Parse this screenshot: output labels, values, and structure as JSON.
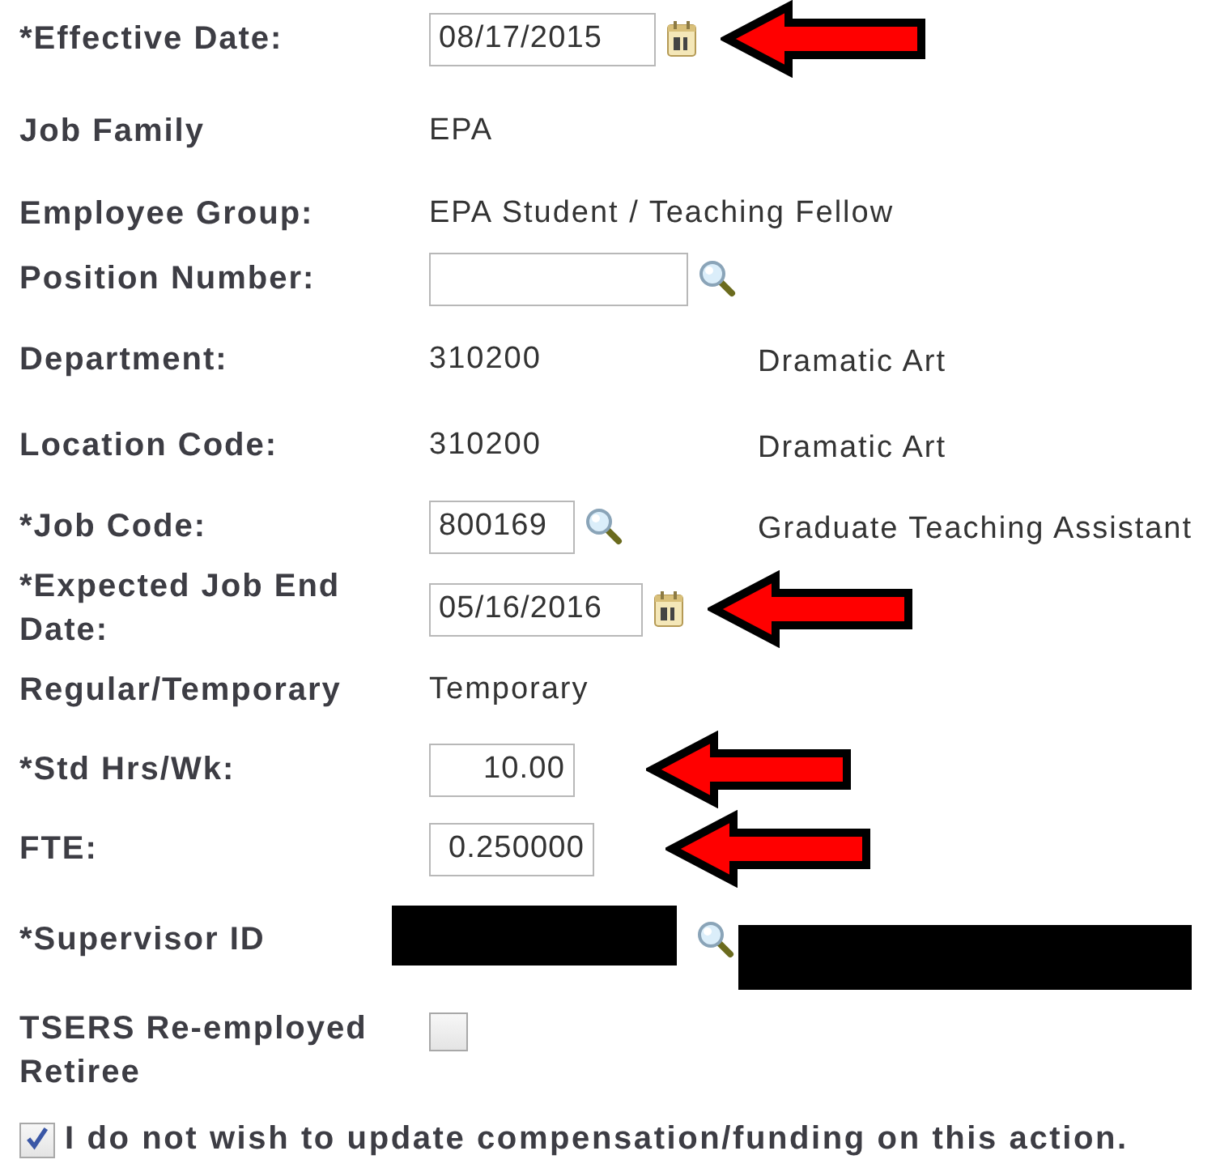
{
  "form": {
    "fields": [
      {
        "label": "*Effective Date:",
        "kind": "date",
        "value": "08/17/2015",
        "arrow": true,
        "redacted": false
      },
      {
        "label": "Job Family",
        "kind": "text",
        "value": "EPA",
        "arrow": false,
        "redacted": false
      },
      {
        "label": "Employee Group:",
        "kind": "text",
        "value": "EPA Student / Teaching Fellow",
        "arrow": false,
        "redacted": false
      },
      {
        "label": "Position Number:",
        "kind": "lookup",
        "arrow": false,
        "redacted": false
      },
      {
        "label": "Department:",
        "kind": "text",
        "value": "310200",
        "description": "Dramatic Art",
        "arrow": false,
        "redacted": false
      },
      {
        "label": "Location Code:",
        "kind": "text",
        "value": "310200",
        "description": "Dramatic Art",
        "arrow": false,
        "redacted": false
      },
      {
        "label": "*Job Code:",
        "kind": "lookup",
        "value": "800169",
        "description": "Graduate Teaching Assistant",
        "arrow": false,
        "redacted": false
      },
      {
        "label": "*Expected Job End Date:",
        "kind": "date",
        "value": "05/16/2016",
        "arrow": true,
        "redacted": false
      },
      {
        "label": "Regular/Temporary",
        "kind": "text",
        "value": "Temporary",
        "arrow": false,
        "redacted": false
      },
      {
        "label": "*Std Hrs/Wk:",
        "kind": "number",
        "value": "10.00",
        "arrow": true,
        "redacted": false
      },
      {
        "label": "FTE:",
        "kind": "number",
        "value": "0.250000",
        "arrow": true,
        "redacted": false
      },
      {
        "label": "*Supervisor ID",
        "kind": "lookup",
        "arrow": false,
        "redacted": true
      },
      {
        "label": "TSERS Re-employed Retiree",
        "kind": "checkbox",
        "checked": false,
        "arrow": false,
        "redacted": false
      }
    ],
    "no_comp_update": {
      "label": "I do not wish to update compensation/funding on this action.",
      "checked": true
    }
  }
}
